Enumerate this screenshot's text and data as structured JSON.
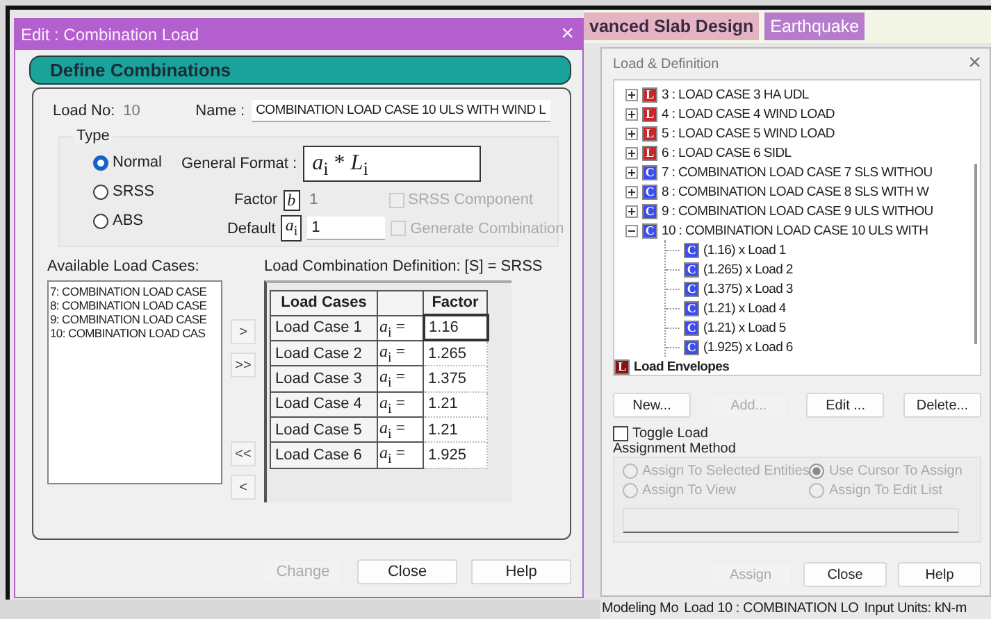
{
  "background_tabs": [
    {
      "label": "vanced Slab Design",
      "selected": true
    },
    {
      "label": "Earthquake",
      "selected": false
    }
  ],
  "dialog": {
    "title": "Edit : Combination Load",
    "close": "×",
    "header": "Define Combinations",
    "load_no_label": "Load No:",
    "load_no": "10",
    "name_label": "Name :",
    "name": "COMBINATION LOAD CASE 10 ULS WITH WIND L",
    "type_label": "Type",
    "types": [
      {
        "label": "Normal",
        "selected": true
      },
      {
        "label": "SRSS",
        "selected": false
      },
      {
        "label": "ABS",
        "selected": false
      }
    ],
    "general_format_label": "General Format :",
    "general_format": "*a*$_{i}$ * *L*$_{i}$",
    "factor_label": "Factor",
    "factor_symbol": "*b*",
    "factor": "1",
    "default_label": "Default",
    "default_symbol": "*a*$_{i}$",
    "default": "1",
    "options": [
      {
        "label": "SRSS Component",
        "checked": false,
        "disabled": true
      },
      {
        "label": "Generate Combination",
        "checked": false,
        "disabled": true
      }
    ],
    "available_label": "Available Load Cases:",
    "available": [
      "7: COMBINATION LOAD CASE",
      "8: COMBINATION LOAD CASE",
      "9: COMBINATION LOAD CASE",
      "10: COMBINATION LOAD CAS"
    ],
    "transfer_buttons": [
      ">",
      ">>",
      "<<",
      "<"
    ],
    "definition_label": "Load Combination Definition:  [S] = SRSS",
    "table": {
      "columns": [
        "Load Cases",
        "Factor"
      ],
      "rows": [
        {
          "load_case": "Load Case 1",
          "coefficient": "*a*$_{i}$ =",
          "factor": "1.16",
          "selected": true
        },
        {
          "load_case": "Load Case 2",
          "coefficient": "*a*$_{i}$ =",
          "factor": "1.265",
          "selected": false
        },
        {
          "load_case": "Load Case 3",
          "coefficient": "*a*$_{i}$ =",
          "factor": "1.375",
          "selected": false
        },
        {
          "load_case": "Load Case 4",
          "coefficient": "*a*$_{i}$ =",
          "factor": "1.21",
          "selected": false
        },
        {
          "load_case": "Load Case 5",
          "coefficient": "*a*$_{i}$ =",
          "factor": "1.21",
          "selected": false
        },
        {
          "load_case": "Load Case 6",
          "coefficient": "*a*$_{i}$ =",
          "factor": "1.925",
          "selected": false
        }
      ]
    },
    "buttons": [
      {
        "label": "Change",
        "disabled": true
      },
      {
        "label": "Close",
        "disabled": false
      },
      {
        "label": "Help",
        "disabled": false
      }
    ]
  },
  "panel": {
    "title": "Load & Definition",
    "close": "×",
    "tree": [
      {
        "kind": "load",
        "icon": "L",
        "label": "3 : LOAD CASE 3 HA UDL",
        "expanded": false
      },
      {
        "kind": "load",
        "icon": "L",
        "label": "4 : LOAD CASE 4 WIND LOAD",
        "expanded": false
      },
      {
        "kind": "load",
        "icon": "L",
        "label": "5 : LOAD CASE 5 WIND LOAD",
        "expanded": false
      },
      {
        "kind": "load",
        "icon": "L",
        "label": "6 : LOAD CASE 6 SIDL",
        "expanded": false
      },
      {
        "kind": "combination",
        "icon": "C",
        "label": "7 : COMBINATION LOAD CASE 7 SLS WITHOU",
        "expanded": false
      },
      {
        "kind": "combination",
        "icon": "C",
        "label": "8 : COMBINATION LOAD CASE 8 SLS WITH W",
        "expanded": false
      },
      {
        "kind": "combination",
        "icon": "C",
        "label": "9 : COMBINATION LOAD CASE 9 ULS WITHOU",
        "expanded": false
      },
      {
        "kind": "combination",
        "icon": "C",
        "label": "10 : COMBINATION LOAD CASE 10 ULS WITH",
        "expanded": true,
        "children": [
          {
            "kind": "combination",
            "icon": "C",
            "label": "(1.16) x Load 1"
          },
          {
            "kind": "combination",
            "icon": "C",
            "label": "(1.265) x Load 2"
          },
          {
            "kind": "combination",
            "icon": "C",
            "label": "(1.375) x Load 3"
          },
          {
            "kind": "combination",
            "icon": "C",
            "label": "(1.21) x Load 4"
          },
          {
            "kind": "combination",
            "icon": "C",
            "label": "(1.21) x Load 5"
          },
          {
            "kind": "combination",
            "icon": "C",
            "label": "(1.925) x Load 6"
          }
        ]
      }
    ],
    "envelopes": {
      "icon": "L",
      "label": "Load Envelopes"
    },
    "buttons": [
      {
        "label": "New...",
        "disabled": false
      },
      {
        "label": "Add...",
        "disabled": true
      },
      {
        "label": "Edit ...",
        "disabled": false
      },
      {
        "label": "Delete...",
        "disabled": false
      }
    ],
    "toggle_load": {
      "label": "Toggle Load",
      "checked": false
    },
    "assignment_label": "Assignment Method",
    "assignment": [
      {
        "label": "Assign To Selected Entities",
        "selected": false,
        "disabled": true
      },
      {
        "label": "Use Cursor To Assign",
        "selected": true,
        "disabled": true
      },
      {
        "label": "Assign To View",
        "selected": false,
        "disabled": true
      },
      {
        "label": "Assign To Edit List",
        "selected": false,
        "disabled": true
      }
    ],
    "bottom_buttons": [
      {
        "label": "Assign",
        "disabled": true
      },
      {
        "label": "Close",
        "disabled": false
      },
      {
        "label": "Help",
        "disabled": false
      }
    ]
  },
  "status_bar": [
    "Modeling Mo",
    "Load 10 : COMBINATION LO",
    "Input Units:  kN-m"
  ]
}
